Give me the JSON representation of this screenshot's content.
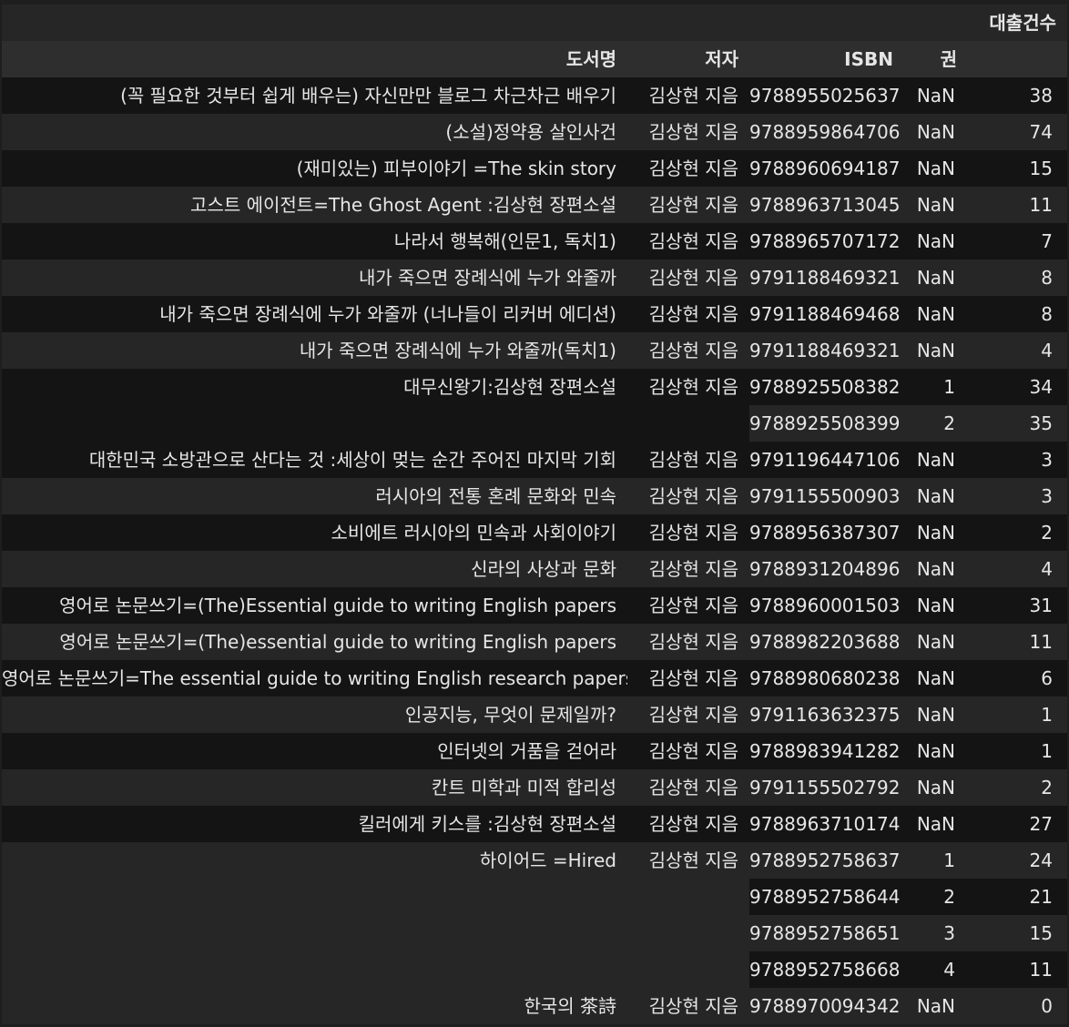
{
  "table": {
    "header_top": {
      "count_label": "대출건수"
    },
    "header_index": {
      "title": "도서명",
      "author": "저자",
      "isbn": "ISBN",
      "volume": "권"
    },
    "groups": [
      {
        "title": "(꼭 필요한 것부터 쉽게 배우는) 자신만만 블로그 차근차근 배우기",
        "author": "김상현 지음",
        "rows": [
          {
            "isbn": "9788955025637",
            "volume": "NaN",
            "count": "38"
          }
        ]
      },
      {
        "title": "(소설)정약용 살인사건",
        "author": "김상현 지음",
        "rows": [
          {
            "isbn": "9788959864706",
            "volume": "NaN",
            "count": "74"
          }
        ]
      },
      {
        "title": "(재미있는) 피부이야기 =The skin story",
        "author": "김상현 지음",
        "rows": [
          {
            "isbn": "9788960694187",
            "volume": "NaN",
            "count": "15"
          }
        ]
      },
      {
        "title": "고스트 에이전트=The Ghost Agent :김상현 장편소설",
        "author": "김상현 지음",
        "rows": [
          {
            "isbn": "9788963713045",
            "volume": "NaN",
            "count": "11"
          }
        ]
      },
      {
        "title": "나라서 행복해(인문1, 독치1)",
        "author": "김상현 지음",
        "rows": [
          {
            "isbn": "9788965707172",
            "volume": "NaN",
            "count": "7"
          }
        ]
      },
      {
        "title": "내가 죽으면 장례식에 누가 와줄까",
        "author": "김상현 지음",
        "rows": [
          {
            "isbn": "9791188469321",
            "volume": "NaN",
            "count": "8"
          }
        ]
      },
      {
        "title": "내가 죽으면 장례식에 누가 와줄까 (너나들이 리커버 에디션)",
        "author": "김상현 지음",
        "rows": [
          {
            "isbn": "9791188469468",
            "volume": "NaN",
            "count": "8"
          }
        ]
      },
      {
        "title": "내가 죽으면 장례식에 누가 와줄까(독치1)",
        "author": "김상현 지음",
        "rows": [
          {
            "isbn": "9791188469321",
            "volume": "NaN",
            "count": "4"
          }
        ]
      },
      {
        "title": "대무신왕기:김상현 장편소설",
        "author": "김상현 지음",
        "rows": [
          {
            "isbn": "9788925508382",
            "volume": "1",
            "count": "34"
          },
          {
            "isbn": "9788925508399",
            "volume": "2",
            "count": "35"
          }
        ]
      },
      {
        "title": "대한민국 소방관으로 산다는 것 :세상이 멎는 순간 주어진 마지막 기회",
        "author": "김상현 지음",
        "rows": [
          {
            "isbn": "9791196447106",
            "volume": "NaN",
            "count": "3"
          }
        ]
      },
      {
        "title": "러시아의 전통 혼례 문화와 민속",
        "author": "김상현 지음",
        "rows": [
          {
            "isbn": "9791155500903",
            "volume": "NaN",
            "count": "3"
          }
        ]
      },
      {
        "title": "소비에트 러시아의 민속과 사회이야기",
        "author": "김상현 지음",
        "rows": [
          {
            "isbn": "9788956387307",
            "volume": "NaN",
            "count": "2"
          }
        ]
      },
      {
        "title": "신라의 사상과 문화",
        "author": "김상현 지음",
        "rows": [
          {
            "isbn": "9788931204896",
            "volume": "NaN",
            "count": "4"
          }
        ]
      },
      {
        "title": "영어로 논문쓰기=(The)Essential guide to writing English papers",
        "author": "김상현 지음",
        "rows": [
          {
            "isbn": "9788960001503",
            "volume": "NaN",
            "count": "31"
          }
        ]
      },
      {
        "title": "영어로 논문쓰기=(The)essential guide to writing English papers",
        "author": "김상현 지음",
        "rows": [
          {
            "isbn": "9788982203688",
            "volume": "NaN",
            "count": "11"
          }
        ]
      },
      {
        "title": "영어로 논문쓰기=The essential guide to writing English research papers",
        "author": "김상현 지음",
        "rows": [
          {
            "isbn": "9788980680238",
            "volume": "NaN",
            "count": "6"
          }
        ]
      },
      {
        "title": "인공지능, 무엇이 문제일까?",
        "author": "김상현 지음",
        "rows": [
          {
            "isbn": "9791163632375",
            "volume": "NaN",
            "count": "1"
          }
        ]
      },
      {
        "title": "인터넷의 거품을 걷어라",
        "author": "김상현 지음",
        "rows": [
          {
            "isbn": "9788983941282",
            "volume": "NaN",
            "count": "1"
          }
        ]
      },
      {
        "title": "칸트 미학과 미적 합리성",
        "author": "김상현 지음",
        "rows": [
          {
            "isbn": "9791155502792",
            "volume": "NaN",
            "count": "2"
          }
        ]
      },
      {
        "title": "킬러에게 키스를 :김상현 장편소설",
        "author": "김상현 지음",
        "rows": [
          {
            "isbn": "9788963710174",
            "volume": "NaN",
            "count": "27"
          }
        ]
      },
      {
        "title": "하이어드 =Hired",
        "author": "김상현 지음",
        "rows": [
          {
            "isbn": "9788952758637",
            "volume": "1",
            "count": "24"
          },
          {
            "isbn": "9788952758644",
            "volume": "2",
            "count": "21"
          },
          {
            "isbn": "9788952758651",
            "volume": "3",
            "count": "15"
          },
          {
            "isbn": "9788952758668",
            "volume": "4",
            "count": "11"
          }
        ]
      },
      {
        "title": "한국의 茶詩",
        "author": "김상현 지음",
        "rows": [
          {
            "isbn": "9788970094342",
            "volume": "NaN",
            "count": "0"
          }
        ]
      }
    ]
  }
}
